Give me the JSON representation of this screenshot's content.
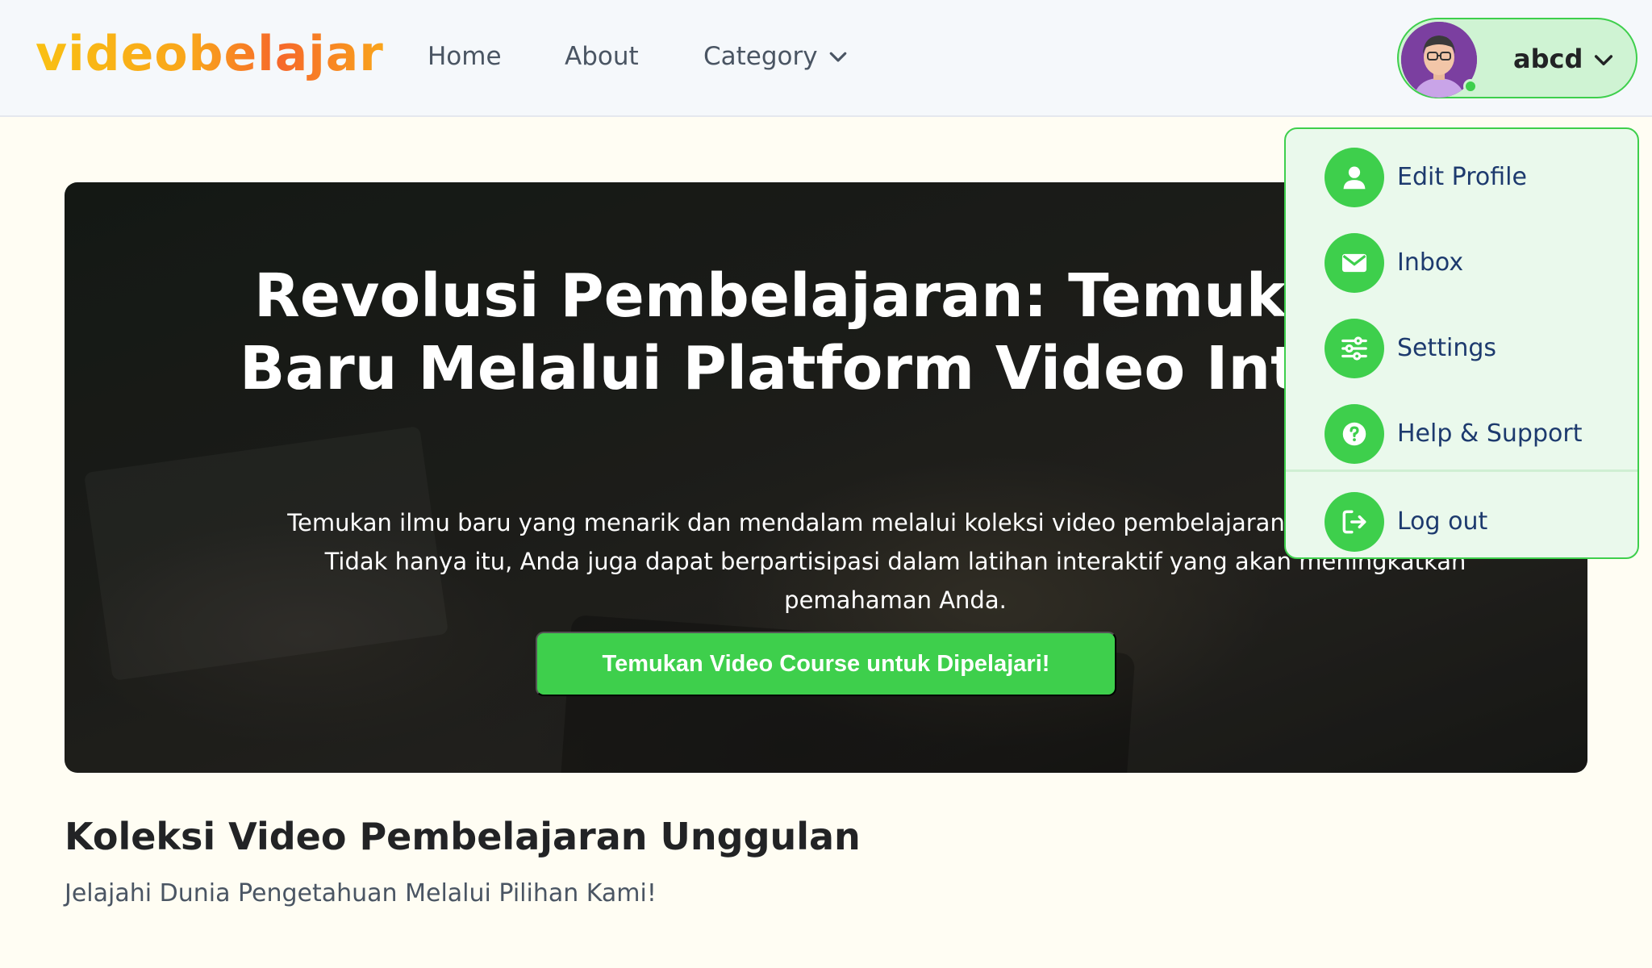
{
  "brand": {
    "logo_text": "videobelajar",
    "accent": "#3ECF4C",
    "logo_gradient": [
      "#F9C013",
      "#F6682B"
    ]
  },
  "nav": {
    "home": "Home",
    "about": "About",
    "category": "Category",
    "category_icon": "chevron-down-icon"
  },
  "profile": {
    "name": "abcd",
    "status": "online",
    "chevron_icon": "chevron-down-icon"
  },
  "hero": {
    "title": "Revolusi Pembelajaran: Temukan Ilmu Baru Melalui Platform Video Interaktif!",
    "description": "Temukan ilmu baru yang menarik dan mendalam melalui koleksi video pembelajaran berkualitas tinggi. Tidak hanya itu, Anda juga dapat berpartisipasi dalam latihan interaktif yang akan meningkatkan pemahaman Anda.",
    "cta_label": "Temukan Video Course untuk Dipelajari!"
  },
  "section": {
    "title": "Koleksi Video Pembelajaran Unggulan",
    "subtitle": "Jelajahi Dunia Pengetahuan Melalui Pilihan Kami!"
  },
  "dropdown": {
    "items": [
      {
        "label": "Edit Profile",
        "icon": "user-icon"
      },
      {
        "label": "Inbox",
        "icon": "mail-icon"
      },
      {
        "label": "Settings",
        "icon": "sliders-icon"
      },
      {
        "label": "Help & Support",
        "icon": "help-icon"
      },
      {
        "label": "Log out",
        "icon": "logout-icon"
      }
    ]
  }
}
